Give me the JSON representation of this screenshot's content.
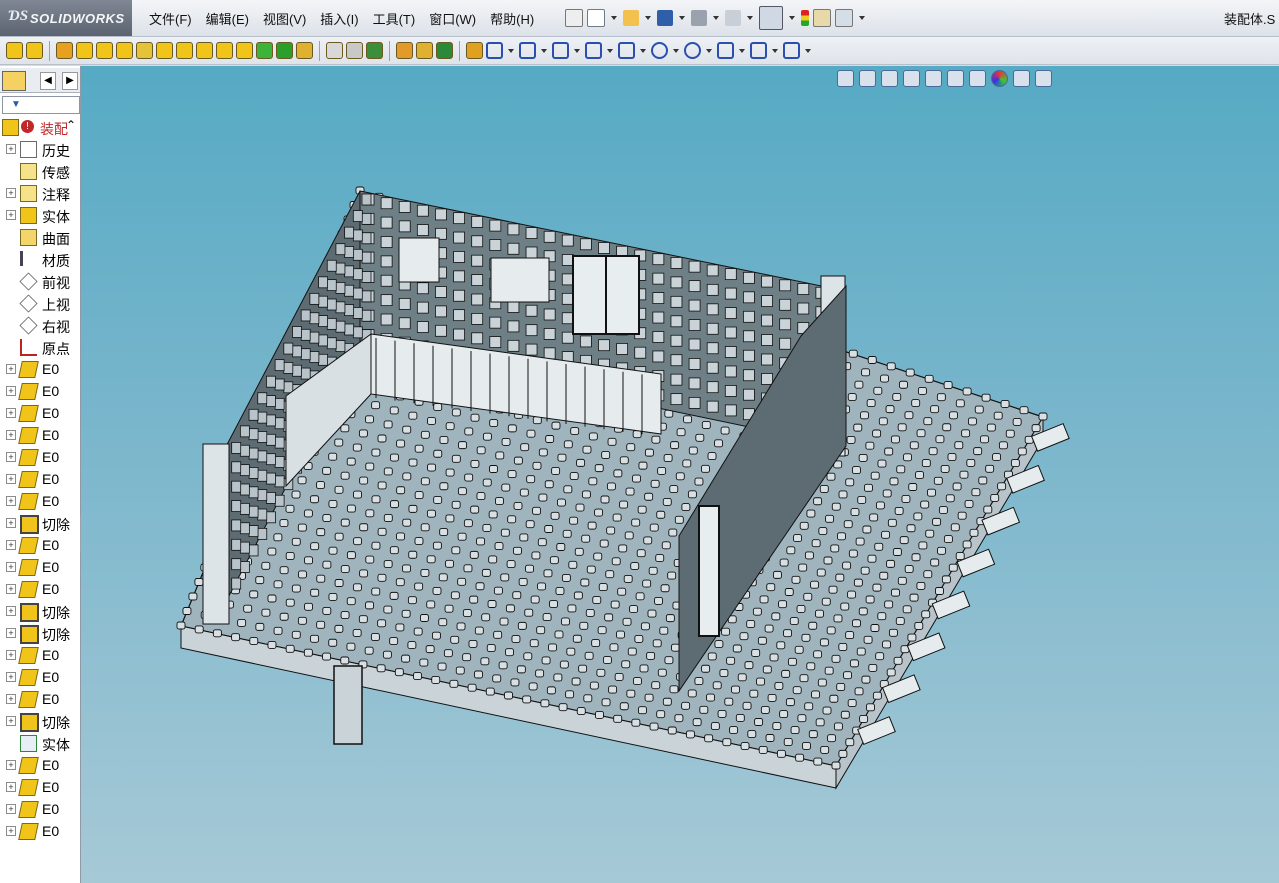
{
  "app": {
    "logo_text": "SOLIDWORKS",
    "document_title": "装配体.S"
  },
  "menu": [
    "文件(F)",
    "编辑(E)",
    "视图(V)",
    "插入(I)",
    "工具(T)",
    "窗口(W)",
    "帮助(H)"
  ],
  "feature_tree": {
    "root_label": "装配",
    "items": [
      {
        "label": "历史",
        "icon": "history-icon",
        "expand": true
      },
      {
        "label": "传感",
        "icon": "sensor-icon",
        "expand": false
      },
      {
        "label": "注释",
        "icon": "annotation-icon",
        "expand": true
      },
      {
        "label": "实体",
        "icon": "solid-body-icon",
        "expand": true
      },
      {
        "label": "曲面",
        "icon": "surface-icon",
        "expand": false
      },
      {
        "label": "材质",
        "icon": "material-icon",
        "expand": false
      },
      {
        "label": "前视",
        "icon": "plane-icon",
        "expand": false
      },
      {
        "label": "上视",
        "icon": "plane-icon",
        "expand": false
      },
      {
        "label": "右视",
        "icon": "plane-icon",
        "expand": false
      },
      {
        "label": "原点",
        "icon": "origin-icon",
        "expand": false
      },
      {
        "label": "E0",
        "icon": "part-icon",
        "expand": true
      },
      {
        "label": "E0",
        "icon": "part-icon",
        "expand": true
      },
      {
        "label": "E0",
        "icon": "part-icon",
        "expand": true
      },
      {
        "label": "E0",
        "icon": "part-icon",
        "expand": true
      },
      {
        "label": "E0",
        "icon": "part-icon",
        "expand": true
      },
      {
        "label": "E0",
        "icon": "part-icon",
        "expand": true
      },
      {
        "label": "E0",
        "icon": "part-icon",
        "expand": true
      },
      {
        "label": "切除",
        "icon": "cut-icon",
        "expand": true
      },
      {
        "label": "E0",
        "icon": "part-icon",
        "expand": true
      },
      {
        "label": "E0",
        "icon": "part-icon",
        "expand": true
      },
      {
        "label": "E0",
        "icon": "part-icon",
        "expand": true
      },
      {
        "label": "切除",
        "icon": "cut-icon",
        "expand": true
      },
      {
        "label": "切除",
        "icon": "cut-icon",
        "expand": true
      },
      {
        "label": "E0",
        "icon": "part-icon",
        "expand": true
      },
      {
        "label": "E0",
        "icon": "part-icon",
        "expand": true
      },
      {
        "label": "E0",
        "icon": "part-icon",
        "expand": true
      },
      {
        "label": "切除",
        "icon": "cut-icon",
        "expand": true
      },
      {
        "label": "实体",
        "icon": "mate-icon",
        "expand": false
      },
      {
        "label": "E0",
        "icon": "part-icon",
        "expand": true
      },
      {
        "label": "E0",
        "icon": "part-icon",
        "expand": true
      },
      {
        "label": "E0",
        "icon": "part-icon",
        "expand": true
      },
      {
        "label": "E0",
        "icon": "part-icon",
        "expand": true
      }
    ]
  },
  "colors": {
    "accent_red": "#c0282a",
    "part_yellow": "#f0c419",
    "viewport_top": "#56aac4"
  }
}
